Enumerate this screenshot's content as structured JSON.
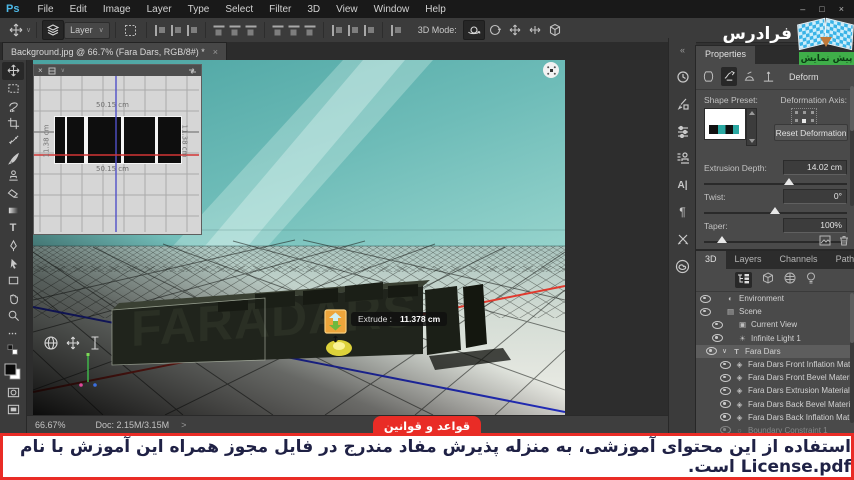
{
  "menubar": {
    "logo": "Ps",
    "items": [
      "File",
      "Edit",
      "Image",
      "Layer",
      "Type",
      "Select",
      "Filter",
      "3D",
      "View",
      "Window",
      "Help"
    ],
    "window_controls": {
      "minimize": "–",
      "restore": "□",
      "close": "×"
    }
  },
  "optionsbar": {
    "tool_preset": "Layer",
    "caret": "∨",
    "check": "✓",
    "mode_label": "3D Mode:"
  },
  "doc_tab": {
    "title": "Background.jpg @ 66.7% (Fara Dars, RGB/8#) *",
    "close": "×"
  },
  "miniview": {
    "close": "×",
    "caret": "∨",
    "top_label": "50.15 cm",
    "bottom_label": "50.15 cm",
    "left_label": "11.38 cm",
    "right_label": "11.38 cm"
  },
  "scene": {
    "extrude_label": "Extrude :",
    "extrude_value": "11.378 cm"
  },
  "statusbar": {
    "zoom": "66.67%",
    "doc_size": "Doc: 2.15M/3.15M",
    "chevron": ">"
  },
  "rightstrip": {
    "collapse": "«",
    "character": "A|",
    "paragraph": "¶"
  },
  "properties": {
    "tab": "Properties",
    "mode_label": "Deform",
    "shape_preset_label": "Shape Preset:",
    "deformation_axis_label": "Deformation Axis:",
    "reset_button": "Reset Deformation",
    "extrusion_label": "Extrusion Depth:",
    "extrusion_value": "14.02 cm",
    "twist_label": "Twist:",
    "twist_value": "0°",
    "taper_label": "Taper:",
    "taper_value": "100%"
  },
  "panel3d": {
    "tabs": [
      "3D",
      "Layers",
      "Channels",
      "Paths"
    ],
    "tree": [
      {
        "icon": "◐",
        "label": "Environment",
        "expander": ""
      },
      {
        "icon": "▤",
        "label": "Scene",
        "expander": ""
      },
      {
        "icon": "▣",
        "label": "Current View",
        "expander": ""
      },
      {
        "icon": "☀",
        "label": "Infinite Light 1",
        "expander": ""
      },
      {
        "icon": "T",
        "label": "Fara Dars",
        "expander": "∨"
      },
      {
        "icon": "◈",
        "label": "Fara Dars Front Inflation Mat...",
        "expander": ""
      },
      {
        "icon": "◈",
        "label": "Fara Dars Front Bevel Material",
        "expander": ""
      },
      {
        "icon": "◈",
        "label": "Fara Dars Extrusion Material",
        "expander": ""
      },
      {
        "icon": "◈",
        "label": "Fara Dars Back Bevel Material",
        "expander": ""
      },
      {
        "icon": "◈",
        "label": "Fara Dars Back Inflation Mat...",
        "expander": ""
      },
      {
        "icon": "○",
        "label": "Boundary Constraint 1",
        "expander": ""
      }
    ]
  },
  "branding": {
    "logo_text": "فرادرس",
    "preview_badge": "پیش نمایش"
  },
  "subtitle": {
    "badge": "قواعد و قوانین",
    "text": "استفاده از این محتوای آموزشی، به منزله پذیرش مفاد مندرج در فایل مجوز همراه این آموزش با نام License.pdf است."
  },
  "colors": {
    "canvas_teal": "#6cbcb7",
    "subtitle_red": "#e92c26",
    "badge_green": "#3fae49",
    "logo_blue": "#37b2e6",
    "gizmo_orange": "#eda53b"
  }
}
